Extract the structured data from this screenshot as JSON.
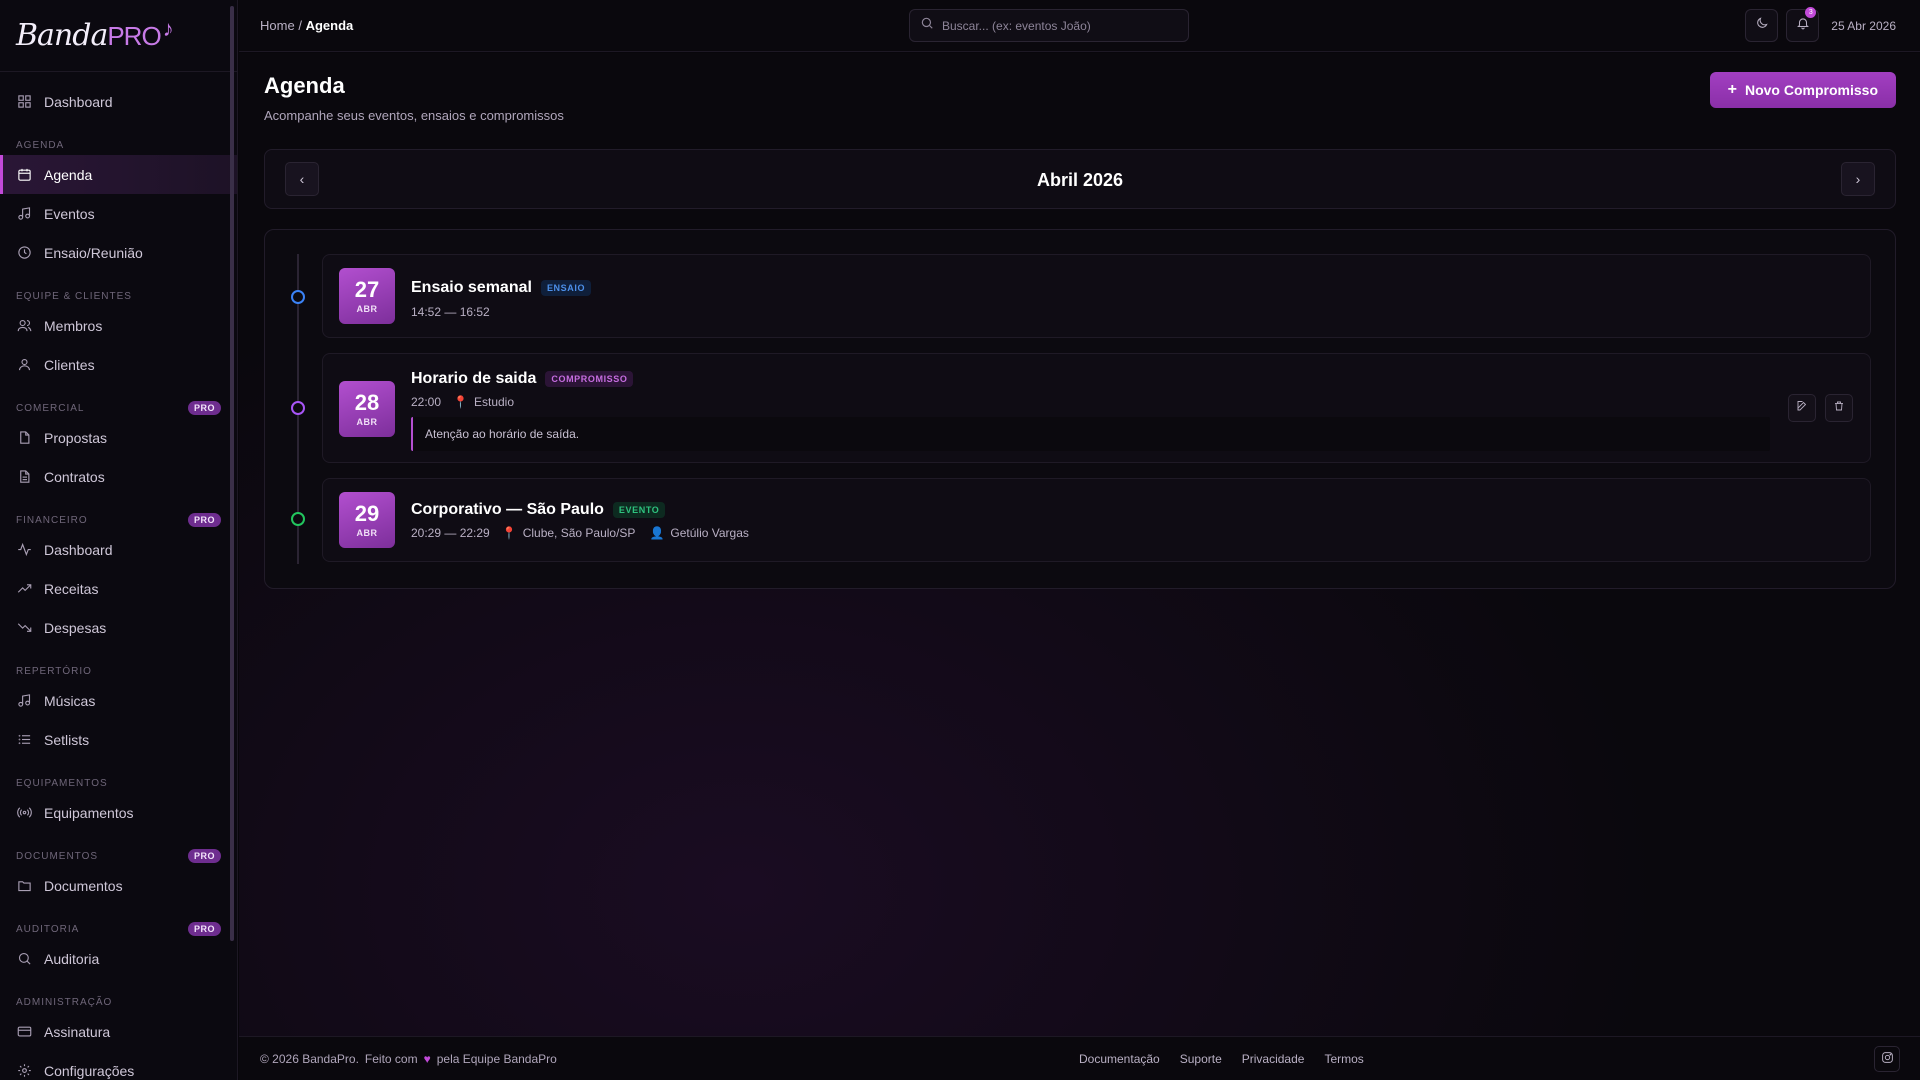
{
  "brand": {
    "name_part1": "Banda",
    "name_part2": "PRO"
  },
  "sidebar": {
    "items": [
      {
        "label": "Dashboard",
        "icon": "grid-icon"
      },
      {
        "section": "AGENDA"
      },
      {
        "label": "Agenda",
        "icon": "calendar-icon",
        "active": true
      },
      {
        "label": "Eventos",
        "icon": "music-note-icon"
      },
      {
        "label": "Ensaio/Reunião",
        "icon": "clock-icon"
      },
      {
        "section": "EQUIPE & CLIENTES"
      },
      {
        "label": "Membros",
        "icon": "users-icon"
      },
      {
        "label": "Clientes",
        "icon": "user-icon"
      },
      {
        "section": "COMERCIAL",
        "badge": "PRO"
      },
      {
        "label": "Propostas",
        "icon": "file-icon"
      },
      {
        "label": "Contratos",
        "icon": "file-text-icon"
      },
      {
        "section": "FINANCEIRO",
        "badge": "PRO"
      },
      {
        "label": "Dashboard",
        "icon": "activity-icon"
      },
      {
        "label": "Receitas",
        "icon": "trending-up-icon"
      },
      {
        "label": "Despesas",
        "icon": "trending-down-icon"
      },
      {
        "section": "REPERTÓRIO"
      },
      {
        "label": "Músicas",
        "icon": "music-note-icon"
      },
      {
        "label": "Setlists",
        "icon": "list-icon"
      },
      {
        "section": "EQUIPAMENTOS"
      },
      {
        "label": "Equipamentos",
        "icon": "radio-icon"
      },
      {
        "section": "DOCUMENTOS",
        "badge": "PRO"
      },
      {
        "label": "Documentos",
        "icon": "folder-icon"
      },
      {
        "section": "AUDITORIA",
        "badge": "PRO"
      },
      {
        "label": "Auditoria",
        "icon": "search-icon"
      },
      {
        "section": "ADMINISTRAÇÃO"
      },
      {
        "label": "Assinatura",
        "icon": "credit-card-icon"
      },
      {
        "label": "Configurações",
        "icon": "gear-icon"
      }
    ]
  },
  "topbar": {
    "breadcrumb_home": "Home",
    "breadcrumb_sep": "/",
    "breadcrumb_current": "Agenda",
    "search_placeholder": "Buscar... (ex: eventos João)",
    "notification_count": "3",
    "date": "25 Abr 2026"
  },
  "page": {
    "title": "Agenda",
    "subtitle": "Acompanhe seus eventos, ensaios e compromissos",
    "new_button": "Novo Compromisso",
    "month": "Abril 2026"
  },
  "events": [
    {
      "day": "27",
      "month": "ABR",
      "title": "Ensaio semanal",
      "tag": "ENSAIO",
      "time": "14:52 — 16:52",
      "color": "#3b82f6"
    },
    {
      "day": "28",
      "month": "ABR",
      "title": "Horario de saida",
      "tag": "COMPROMISSO",
      "time": "22:00",
      "location": "Estudio",
      "note": "Atenção ao horário de saída.",
      "color": "#a855f7"
    },
    {
      "day": "29",
      "month": "ABR",
      "title": "Corporativo — São Paulo",
      "tag": "EVENTO",
      "time": "20:29 — 22:29",
      "location": "Clube, São Paulo/SP",
      "person": "Getúlio Vargas",
      "color": "#22c55e"
    }
  ],
  "footer": {
    "copyright": "© 2026 BandaPro.",
    "made_with": "Feito com",
    "by": "pela Equipe BandaPro",
    "links": [
      "Documentação",
      "Suporte",
      "Privacidade",
      "Termos"
    ]
  },
  "colors": {
    "accent": "#a23fc1",
    "background": "#08060b"
  }
}
